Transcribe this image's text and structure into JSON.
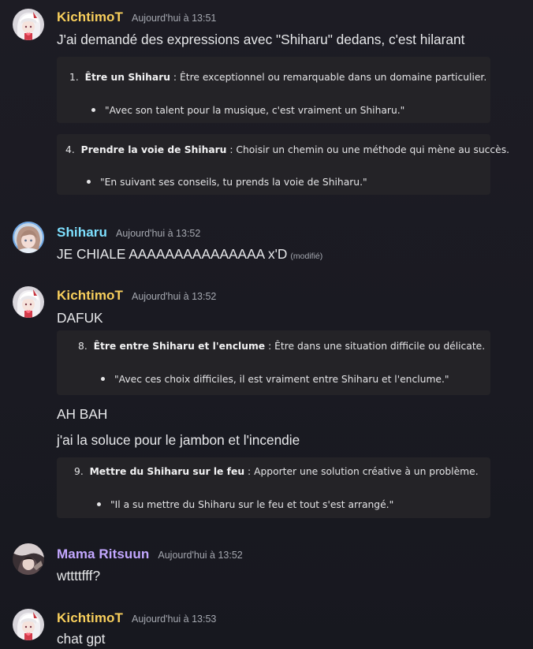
{
  "colors": {
    "kichtimot": "#f8cf5c",
    "shiharu": "#7ee0ff",
    "mama_ritsuun": "#c3a7ff"
  },
  "messages": [
    {
      "author": "KichtimoT",
      "timestamp": "Aujourd'hui à 13:51",
      "text": "J'ai demandé des expressions avec \"Shiharu\" dedans, c'est hilarant",
      "embeds": [
        {
          "number": "1.",
          "term": "Être un Shiharu",
          "definition": " : Être exceptionnel ou remarquable dans un domaine particulier.",
          "example": "\"Avec son talent pour la musique, c'est vraiment un Shiharu.\""
        },
        {
          "number": "4.",
          "term": "Prendre la voie de Shiharu",
          "definition": " : Choisir un chemin ou une méthode qui mène au succès.",
          "example": "\"En suivant ses conseils, tu prends la voie de Shiharu.\""
        }
      ]
    },
    {
      "author": "Shiharu",
      "timestamp": "Aujourd'hui à 13:52",
      "text": "JE CHIALE AAAAAAAAAAAAAAA x'D",
      "edited": "(modifié)"
    },
    {
      "author": "KichtimoT",
      "timestamp": "Aujourd'hui à 13:52",
      "text": "DAFUK",
      "embeds": [
        {
          "number": "8.",
          "term": "Être entre Shiharu et l'enclume",
          "definition": " : Être dans une situation difficile ou délicate.",
          "example": "\"Avec ces choix difficiles, il est vraiment entre Shiharu et l'enclume.\""
        }
      ],
      "followups": [
        "AH BAH",
        "j'ai la soluce pour le jambon et l'incendie"
      ],
      "embeds2": [
        {
          "number": "9.",
          "term": "Mettre du Shiharu sur le feu",
          "definition": " : Apporter une solution créative à un problème.",
          "example": "\"Il a su mettre du Shiharu sur le feu et tout s'est arrangé.\""
        }
      ]
    },
    {
      "author": "Mama Ritsuun",
      "timestamp": "Aujourd'hui à 13:52",
      "text": "wttttfff?"
    },
    {
      "author": "KichtimoT",
      "timestamp": "Aujourd'hui à 13:53",
      "text": "chat gpt"
    }
  ]
}
